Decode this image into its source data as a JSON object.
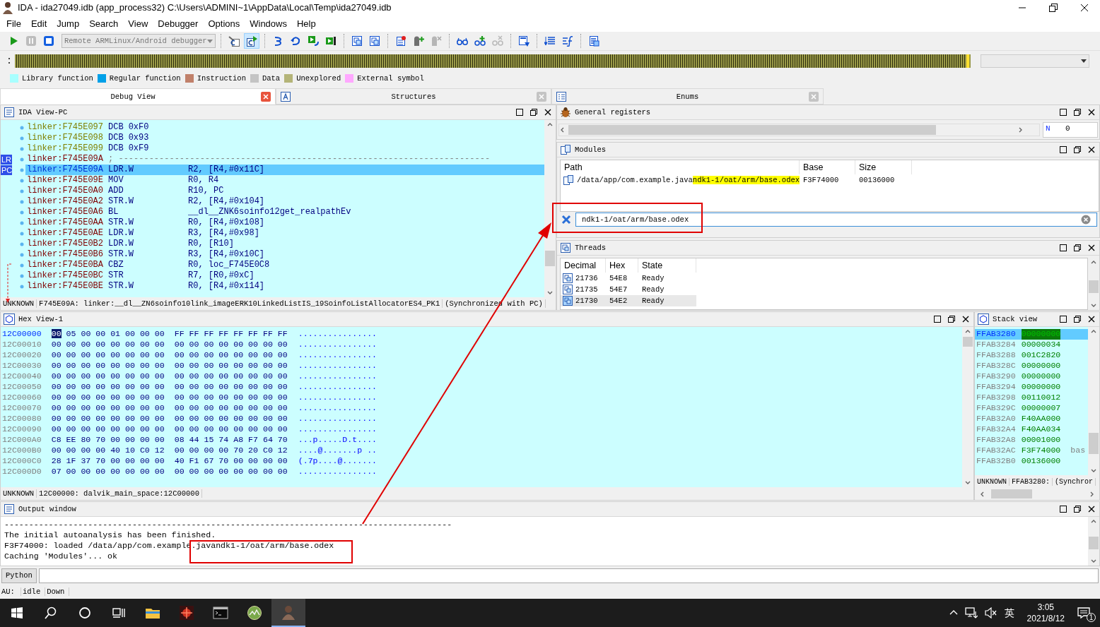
{
  "window": {
    "title": "IDA - ida27049.idb (app_process32) C:\\Users\\ADMINI~1\\AppData\\Local\\Temp\\ida27049.idb"
  },
  "menu": [
    "File",
    "Edit",
    "Jump",
    "Search",
    "View",
    "Debugger",
    "Options",
    "Windows",
    "Help"
  ],
  "toolbar": {
    "items": [
      {
        "kind": "run",
        "pressed": false,
        "disabled": false
      },
      {
        "kind": "pause",
        "pressed": false,
        "disabled": true
      },
      {
        "kind": "stop",
        "pressed": false,
        "disabled": false
      },
      {
        "kind": "debugger_select",
        "value": "Remote ARMLinux/Android debugger"
      },
      {
        "kind": "separator"
      },
      {
        "kind": "attach",
        "pressed": false,
        "disabled": false
      },
      {
        "kind": "code_run",
        "pressed": true,
        "disabled": false
      },
      {
        "kind": "separator"
      },
      {
        "kind": "step_into",
        "pressed": false,
        "disabled": false
      },
      {
        "kind": "step_over",
        "pressed": false,
        "disabled": false
      },
      {
        "kind": "run_to_cursor",
        "pressed": false,
        "disabled": false
      },
      {
        "kind": "step_out",
        "pressed": false,
        "disabled": false
      },
      {
        "kind": "separator"
      },
      {
        "kind": "windows",
        "pressed": false,
        "disabled": false
      },
      {
        "kind": "windows",
        "pressed": false,
        "disabled": false
      },
      {
        "kind": "separator"
      },
      {
        "kind": "breakpoints",
        "pressed": false,
        "disabled": false
      },
      {
        "kind": "bpt_add",
        "pressed": false,
        "disabled": false
      },
      {
        "kind": "bpt_del",
        "pressed": false,
        "disabled": true
      },
      {
        "kind": "separator"
      },
      {
        "kind": "watch",
        "pressed": false,
        "disabled": false
      },
      {
        "kind": "watch_add",
        "pressed": false,
        "disabled": false
      },
      {
        "kind": "watch_del",
        "pressed": false,
        "disabled": true
      },
      {
        "kind": "separator"
      },
      {
        "kind": "doc_down",
        "pressed": false,
        "disabled": false
      },
      {
        "kind": "separator"
      },
      {
        "kind": "list_down",
        "pressed": false,
        "disabled": false
      },
      {
        "kind": "func",
        "pressed": false,
        "disabled": false
      },
      {
        "kind": "separator"
      },
      {
        "kind": "doc_list",
        "pressed": false,
        "disabled": false
      }
    ]
  },
  "legend": [
    {
      "label": "Library function",
      "color": "#a8ffff"
    },
    {
      "label": "Regular function",
      "color": "#00a0e8"
    },
    {
      "label": "Instruction",
      "color": "#c0806a"
    },
    {
      "label": "Data",
      "color": "#c4c4c4"
    },
    {
      "label": "Unexplored",
      "color": "#b4b478"
    },
    {
      "label": "External symbol",
      "color": "#ffa8ff"
    }
  ],
  "tabs": [
    {
      "label": "Debug View",
      "selected": true
    },
    {
      "label": "Structures",
      "selected": false
    },
    {
      "label": "Enums",
      "selected": false
    }
  ],
  "ida_view": {
    "title": "IDA View-PC",
    "lines": [
      {
        "kind": "data",
        "address": "linker:F745E097",
        "mnemonic": "DCB",
        "operands": "0xF0",
        "selected": false
      },
      {
        "kind": "data",
        "address": "linker:F745E098",
        "mnemonic": "DCB",
        "operands": "0x93",
        "selected": false
      },
      {
        "kind": "data",
        "address": "linker:F745E099",
        "mnemonic": "DCB",
        "operands": "0xF9",
        "selected": false
      },
      {
        "kind": "comment",
        "address": "linker:F745E09A",
        "mnemonic": "; -------------------------------------------------------------------------",
        "marker": "LR",
        "selected": false
      },
      {
        "kind": "code",
        "address": "linker:F745E09A",
        "mnemonic": "LDR.W",
        "operands": "R2, [R4,#0x11C]",
        "marker": "PC",
        "selected": true
      },
      {
        "kind": "code",
        "address": "linker:F745E09E",
        "mnemonic": "MOV",
        "operands": "R0, R4",
        "selected": false
      },
      {
        "kind": "code",
        "address": "linker:F745E0A0",
        "mnemonic": "ADD",
        "operands": "R10, PC",
        "selected": false
      },
      {
        "kind": "code",
        "address": "linker:F745E0A2",
        "mnemonic": "STR.W",
        "operands": "R2, [R4,#0x104]",
        "selected": false
      },
      {
        "kind": "code",
        "address": "linker:F745E0A6",
        "mnemonic": "BL",
        "operands": "__dl__ZNK6soinfo12get_realpathEv",
        "selected": false
      },
      {
        "kind": "code",
        "address": "linker:F745E0AA",
        "mnemonic": "STR.W",
        "operands": "R0, [R4,#0x108]",
        "selected": false
      },
      {
        "kind": "code",
        "address": "linker:F745E0AE",
        "mnemonic": "LDR.W",
        "operands": "R3, [R4,#0x98]",
        "selected": false
      },
      {
        "kind": "code",
        "address": "linker:F745E0B2",
        "mnemonic": "LDR.W",
        "operands": "R0, [R10]",
        "selected": false
      },
      {
        "kind": "code",
        "address": "linker:F745E0B6",
        "mnemonic": "STR.W",
        "operands": "R3, [R4,#0x10C]",
        "selected": false
      },
      {
        "kind": "code",
        "address": "linker:F745E0BA",
        "mnemonic": "CBZ",
        "operands": "R0, loc_F745E0C8",
        "selected": false
      },
      {
        "kind": "code",
        "address": "linker:F745E0BC",
        "mnemonic": "STR",
        "operands": "R7, [R0,#0xC]",
        "selected": false
      },
      {
        "kind": "code",
        "address": "linker:F745E0BE",
        "mnemonic": "STR.W",
        "operands": "R0, [R4,#0x114]",
        "selected": false
      }
    ],
    "status": {
      "type": "UNKNOWN",
      "location": "F745E09A: linker:__dl__ZN6soinfo10link_imageERK10LinkedListIS_19SoinfoListAllocatorES4_PK1",
      "sync": "(Synchronized with PC)"
    }
  },
  "registers": {
    "title": "General registers",
    "flags": [
      {
        "name": "N",
        "value": "0"
      }
    ]
  },
  "modules": {
    "title": "Modules",
    "columns": [
      "Path",
      "Base",
      "Size"
    ],
    "rows": [
      {
        "path_parts": [
          {
            "text": "/data/app/com.example.java",
            "match": false
          },
          {
            "text": "ndk1-1/oat/arm/base.odex",
            "match": true
          }
        ],
        "base": "F3F74000",
        "size": "00136000"
      }
    ],
    "filter": "ndk1-1/oat/arm/base.odex"
  },
  "threads": {
    "title": "Threads",
    "columns": [
      "Decimal",
      "Hex",
      "State"
    ],
    "rows": [
      {
        "decimal": "21736",
        "hex": "54E8",
        "state": "Ready",
        "selected": false
      },
      {
        "decimal": "21735",
        "hex": "54E7",
        "state": "Ready",
        "selected": false
      },
      {
        "decimal": "21730",
        "hex": "54E2",
        "state": "Ready",
        "selected": true
      }
    ]
  },
  "hex_view": {
    "title": "Hex View-1",
    "rows": [
      {
        "address": "12C00000",
        "bytes": "00 05 00 00 01 00 00 00",
        "bytes2": "FF FF FF FF FF FF FF FF",
        "ascii": "................",
        "selected": true
      },
      {
        "address": "12C00010",
        "bytes": "00 00 00 00 00 00 00 00",
        "bytes2": "00 00 00 00 00 00 00 00",
        "ascii": "................",
        "selected": false
      },
      {
        "address": "12C00020",
        "bytes": "00 00 00 00 00 00 00 00",
        "bytes2": "00 00 00 00 00 00 00 00",
        "ascii": "................",
        "selected": false
      },
      {
        "address": "12C00030",
        "bytes": "00 00 00 00 00 00 00 00",
        "bytes2": "00 00 00 00 00 00 00 00",
        "ascii": "................",
        "selected": false
      },
      {
        "address": "12C00040",
        "bytes": "00 00 00 00 00 00 00 00",
        "bytes2": "00 00 00 00 00 00 00 00",
        "ascii": "................",
        "selected": false
      },
      {
        "address": "12C00050",
        "bytes": "00 00 00 00 00 00 00 00",
        "bytes2": "00 00 00 00 00 00 00 00",
        "ascii": "................",
        "selected": false
      },
      {
        "address": "12C00060",
        "bytes": "00 00 00 00 00 00 00 00",
        "bytes2": "00 00 00 00 00 00 00 00",
        "ascii": "................",
        "selected": false
      },
      {
        "address": "12C00070",
        "bytes": "00 00 00 00 00 00 00 00",
        "bytes2": "00 00 00 00 00 00 00 00",
        "ascii": "................",
        "selected": false
      },
      {
        "address": "12C00080",
        "bytes": "00 00 00 00 00 00 00 00",
        "bytes2": "00 00 00 00 00 00 00 00",
        "ascii": "................",
        "selected": false
      },
      {
        "address": "12C00090",
        "bytes": "00 00 00 00 00 00 00 00",
        "bytes2": "00 00 00 00 00 00 00 00",
        "ascii": "................",
        "selected": false
      },
      {
        "address": "12C000A0",
        "bytes": "C8 EE 80 70 00 00 00 00",
        "bytes2": "08 44 15 74 A8 F7 64 70",
        "ascii": "...p.....D.t....",
        "selected": false
      },
      {
        "address": "12C000B0",
        "bytes": "00 00 00 00 40 10 C0 12",
        "bytes2": "00 00 00 00 70 20 C0 12",
        "ascii": "....@.......p ..",
        "selected": false
      },
      {
        "address": "12C000C0",
        "bytes": "28 1F 37 70 00 00 00 00",
        "bytes2": "40 F1 67 70 00 00 00 00",
        "ascii": "(.7p....@.......",
        "selected": false
      },
      {
        "address": "12C000D0",
        "bytes": "07 00 00 00 00 00 00 00",
        "bytes2": "00 00 00 00 00 00 00 00",
        "ascii": "................",
        "selected": false
      }
    ],
    "status": {
      "type": "UNKNOWN",
      "location": "12C00000: dalvik_main_space:12C00000"
    }
  },
  "stack_view": {
    "title": "Stack view",
    "rows": [
      {
        "address": "FFAB3280",
        "value": "00000000",
        "selected": true
      },
      {
        "address": "FFAB3284",
        "value": "00000034",
        "selected": false
      },
      {
        "address": "FFAB3288",
        "value": "001C2820",
        "selected": false
      },
      {
        "address": "FFAB328C",
        "value": "00000000",
        "selected": false
      },
      {
        "address": "FFAB3290",
        "value": "00000000",
        "selected": false
      },
      {
        "address": "FFAB3294",
        "value": "00000000",
        "selected": false
      },
      {
        "address": "FFAB3298",
        "value": "00110012",
        "selected": false
      },
      {
        "address": "FFAB329C",
        "value": "00000007",
        "selected": false
      },
      {
        "address": "FFAB32A0",
        "value": "F40AA000",
        "selected": false
      },
      {
        "address": "FFAB32A4",
        "value": "F40AA034",
        "selected": false
      },
      {
        "address": "FFAB32A8",
        "value": "00001000",
        "selected": false
      },
      {
        "address": "FFAB32AC",
        "value": "F3F74000",
        "comment": "bas",
        "selected": false
      },
      {
        "address": "FFAB32B0",
        "value": "00136000",
        "selected": false
      }
    ],
    "status": {
      "type": "UNKNOWN",
      "location": "FFAB3280:",
      "sync": "(Synchror"
    }
  },
  "output": {
    "title": "Output window",
    "lines": [
      "-------------------------------------------------------------------------------------------",
      "The initial autoanalysis has been finished.",
      "F3F74000: loaded /data/app/com.example.javandk1-1/oat/arm/base.odex",
      "Caching 'Modules'... ok"
    ]
  },
  "python": {
    "button": "Python"
  },
  "status_bar": {
    "label": "AU:",
    "state": "idle",
    "direction": "Down"
  },
  "taskbar": {
    "apps": [
      {
        "kind": "explorer",
        "active": false
      },
      {
        "kind": "ida",
        "active": false
      },
      {
        "kind": "terminal",
        "active": false
      },
      {
        "kind": "monitor",
        "active": false
      },
      {
        "kind": "avatar",
        "active": true
      }
    ],
    "ime": "英",
    "time": "3:05",
    "date": "2021/8/12",
    "notifications": "1"
  }
}
